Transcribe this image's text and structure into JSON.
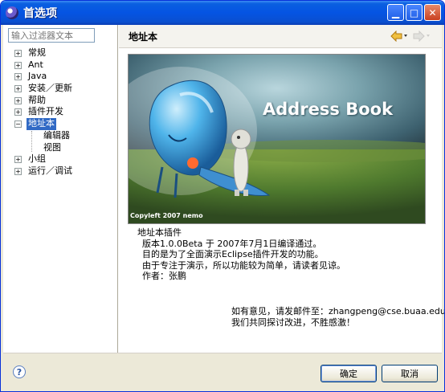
{
  "window": {
    "title": "首选项"
  },
  "filter": {
    "placeholder": "输入过滤器文本"
  },
  "tree": {
    "items": [
      {
        "label": "常规",
        "expander": "+"
      },
      {
        "label": "Ant",
        "expander": "+"
      },
      {
        "label": "Java",
        "expander": "+"
      },
      {
        "label": "安装／更新",
        "expander": "+"
      },
      {
        "label": "帮助",
        "expander": "+"
      },
      {
        "label": "插件开发",
        "expander": "+"
      },
      {
        "label": "地址本",
        "expander": "−"
      },
      {
        "label": "编辑器"
      },
      {
        "label": "视图"
      },
      {
        "label": "小组",
        "expander": "+"
      },
      {
        "label": "运行／调试",
        "expander": "+"
      }
    ]
  },
  "page": {
    "title": "地址本",
    "banner_title": "Address Book",
    "banner_caption": "Copyleft 2007 nemo",
    "desc": [
      "地址本插件",
      "版本1.0.0Beta 于 2007年7月1日编译通过。",
      "目的是为了全面演示Eclipse插件开发的功能。",
      "由于专注于演示，所以功能较为简单，请读者见谅。",
      "作者：张鹏"
    ],
    "contact": [
      "如有意见，请发邮件至：zhangpeng@cse.buaa.edu.cn",
      "我们共同探讨改进，不胜感激！"
    ]
  },
  "buttons": {
    "ok": "确定",
    "cancel": "取消",
    "help": "?"
  },
  "colors": {
    "titlebar": "#0554e3",
    "selection": "#316ac5",
    "nav_arrow": "#e8a020"
  }
}
